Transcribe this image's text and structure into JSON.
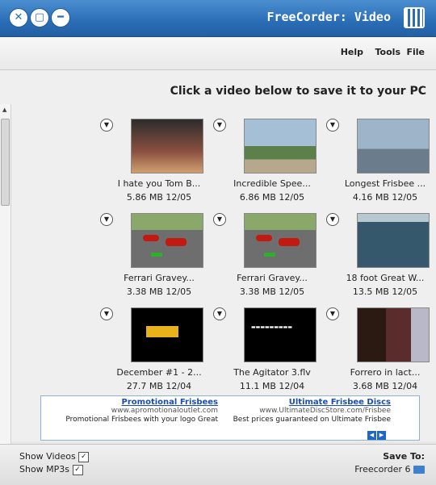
{
  "window": {
    "title": "FreeCorder: Video",
    "close_glyph": "✕",
    "maximize_glyph": "▢",
    "minimize_glyph": "━"
  },
  "menu": {
    "file": "File",
    "tools": "Tools",
    "help": "Help"
  },
  "content": {
    "heading": "Click a video below to save it to your PC",
    "videos": [
      {
        "caption": "Longest Frisbee ...",
        "meta": "4.16 MB 12/05",
        "thumb": "frisbee-players"
      },
      {
        "caption": "Incredible Spee...",
        "meta": "6.86 MB 12/05",
        "thumb": "beach-frisbee"
      },
      {
        "caption": "I hate you Tom B...",
        "meta": "5.86 MB 12/05",
        "thumb": "teens"
      },
      {
        "caption": "18 foot Great W...",
        "meta": "13.5 MB 12/05",
        "thumb": "ocean"
      },
      {
        "caption": "Ferrari Gravey...",
        "meta": "3.38 MB 12/05",
        "thumb": "road-cars"
      },
      {
        "caption": "Ferrari Gravey...",
        "meta": "3.38 MB 12/05",
        "thumb": "road-cars"
      },
      {
        "caption": "Forrero in lact...",
        "meta": "3.68 MB 12/04",
        "thumb": "talking-head"
      },
      {
        "caption": "The Agitator 3.flv",
        "meta": "11.1 MB 12/04",
        "thumb": "title-card"
      },
      {
        "caption": "December #1 - 2...",
        "meta": "27.7 MB 12/04",
        "thumb": "logo-card"
      }
    ]
  },
  "ad": {
    "left": {
      "title": "Ultimate Frisbee Discs",
      "url": "www.UltimateDiscStore.com/Frisbee",
      "text": "Best prices guaranteed on Ultimate Frisbee"
    },
    "right": {
      "title": "Promotional Frisbees",
      "url": "www.apromotionaloutlet.com",
      "text": "Promotional Frisbees with your logo Great"
    }
  },
  "bottom": {
    "save_to_label": "Save To:",
    "folder": "Freecorder 6",
    "show_videos": "Show Videos",
    "show_mp3s": "Show MP3s",
    "check_glyph": "✓"
  },
  "colors": {
    "titlebar": "#2a6db6",
    "ad_link": "#1a4db0",
    "bar_green": "#2cb02c"
  }
}
